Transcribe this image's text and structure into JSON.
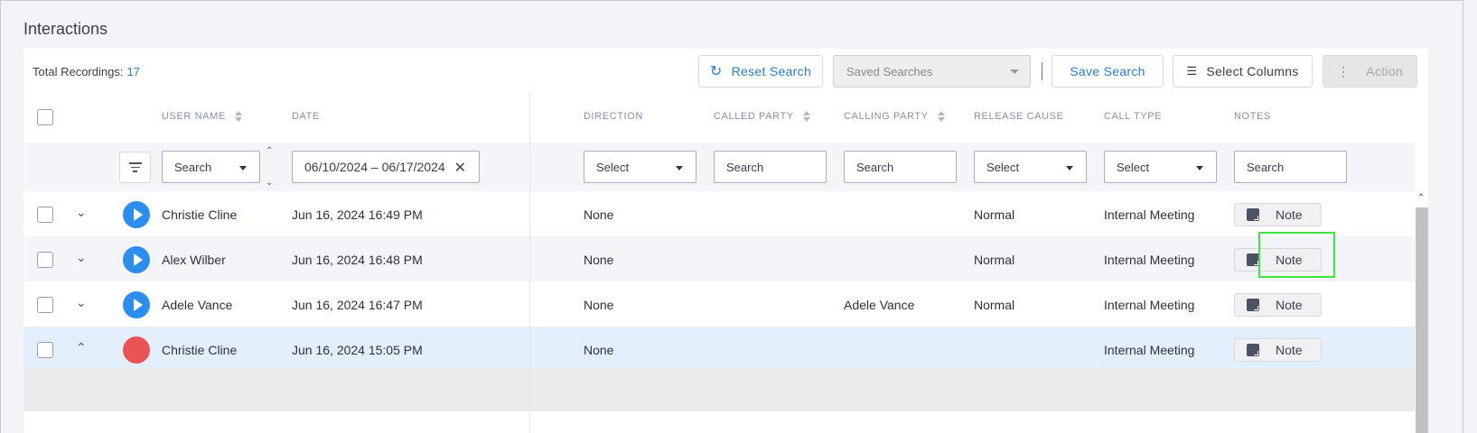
{
  "page": {
    "title": "Interactions"
  },
  "toolbar": {
    "total_label": "Total Recordings:",
    "total_count": "17",
    "reset_label": "Reset Search",
    "saved_searches_placeholder": "Saved Searches",
    "save_label": "Save Search",
    "columns_label": "Select Columns",
    "action_label": "Action"
  },
  "columns": {
    "user_name": "USER NAME",
    "date": "DATE",
    "direction": "DIRECTION",
    "called_party": "CALLED PARTY",
    "calling_party": "CALLING PARTY",
    "release_cause": "RELEASE CAUSE",
    "call_type": "CALL TYPE",
    "notes": "NOTES"
  },
  "filters": {
    "user_name": "Search",
    "date_range": "06/10/2024 – 06/17/2024",
    "direction": "Select",
    "called_party": "Search",
    "calling_party": "Search",
    "release_cause": "Select",
    "call_type": "Select",
    "notes": "Search"
  },
  "rows": [
    {
      "user": "Christie Cline",
      "date": "Jun 16, 2024 16:49 PM",
      "direction": "None",
      "called": "",
      "calling": "",
      "release": "Normal",
      "type": "Internal Meeting",
      "note": "Note",
      "expanded": false,
      "status": "play"
    },
    {
      "user": "Alex Wilber",
      "date": "Jun 16, 2024 16:48 PM",
      "direction": "None",
      "called": "",
      "calling": "",
      "release": "Normal",
      "type": "Internal Meeting",
      "note": "Note",
      "expanded": false,
      "status": "play"
    },
    {
      "user": "Adele Vance",
      "date": "Jun 16, 2024 16:47 PM",
      "direction": "None",
      "called": "",
      "calling": "Adele Vance",
      "release": "Normal",
      "type": "Internal Meeting",
      "note": "Note",
      "expanded": false,
      "status": "play"
    },
    {
      "user": "Christie Cline",
      "date": "Jun 16, 2024 15:05 PM",
      "direction": "None",
      "called": "",
      "calling": "",
      "release": "",
      "type": "Internal Meeting",
      "note": "Note",
      "expanded": true,
      "status": "recording"
    }
  ],
  "colors": {
    "accent": "#2a7ec9",
    "play": "#2b8def",
    "record": "#ea5455",
    "selected_row": "#e3f0fb",
    "alt_row": "#f4f5f9",
    "highlight": "#3ee63e"
  },
  "icons": {
    "reset": "reset-icon",
    "columns": "columns-icon",
    "action": "kebab-icon",
    "filter": "filter-icon",
    "play": "play-icon",
    "record": "record-icon",
    "note": "note-icon"
  }
}
